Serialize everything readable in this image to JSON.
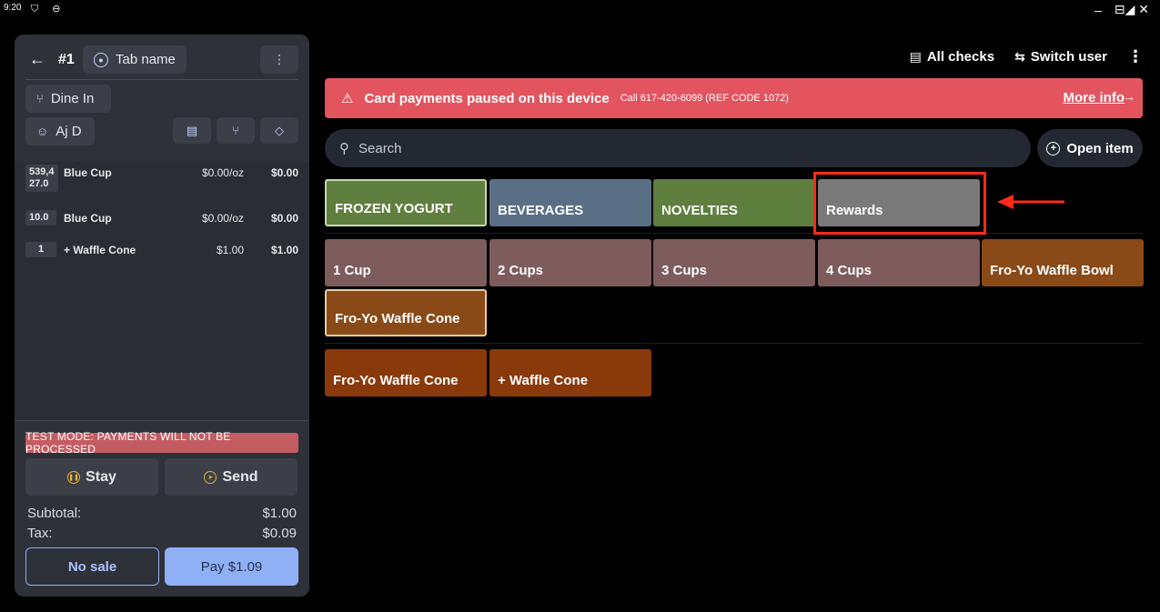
{
  "status_bar": {
    "time": "9:20",
    "left_icons": "⛉ ⊖",
    "minimize": "–",
    "right_icons": "⊟◢ ✕"
  },
  "check": {
    "back_arrow": "←",
    "number": "#1",
    "tab_name": "Tab name",
    "kebab": "⋮",
    "dine_in": "Dine In",
    "server": "Aj D"
  },
  "order_items": [
    {
      "qty": "539,4\n27.0",
      "name": "Blue Cup",
      "unit": "$0.00/oz",
      "total": "$0.00"
    },
    {
      "qty": "10.0",
      "name": "Blue Cup",
      "unit": "$0.00/oz",
      "total": "$0.00"
    },
    {
      "qty": "1",
      "name": "+ Waffle Cone",
      "unit": "$1.00",
      "total": "$1.00"
    }
  ],
  "footer": {
    "test_mode": "TEST MODE:  PAYMENTS WILL NOT BE PROCESSED",
    "stay": "Stay",
    "send": "Send",
    "subtotal_label": "Subtotal:",
    "subtotal_value": "$1.00",
    "tax_label": "Tax:",
    "tax_value": "$0.09",
    "no_sale": "No sale",
    "pay": "Pay $1.09"
  },
  "top_actions": {
    "all_checks": "All checks",
    "switch_user": "Switch user",
    "kebab": "⋮"
  },
  "banner": {
    "message": "Card payments paused on this device",
    "phone": "Call 617-420-6099 (REF CODE 1072)",
    "more_info": "More info",
    "arrow": "→",
    "color": "#e3545f"
  },
  "search": {
    "placeholder": "Search",
    "open_item": "Open item"
  },
  "categories": [
    {
      "label": "FROZEN YOGURT",
      "color": "#5f7f3f"
    },
    {
      "label": "BEVERAGES",
      "color": "#5a6f85"
    },
    {
      "label": "NOVELTIES",
      "color": "#5f7f3f"
    },
    {
      "label": "Rewards",
      "color": "#7a7a7a"
    }
  ],
  "items_row1": [
    {
      "label": "1 Cup",
      "color": "#7e5c5c"
    },
    {
      "label": "2 Cups",
      "color": "#7e5c5c"
    },
    {
      "label": "3 Cups",
      "color": "#7e5c5c"
    },
    {
      "label": "4 Cups",
      "color": "#7e5c5c"
    },
    {
      "label": "Fro-Yo Waffle Bowl",
      "color": "#8a4a17"
    }
  ],
  "items_row2": [
    {
      "label": "Fro-Yo Waffle Cone",
      "color": "#8a4a17"
    }
  ],
  "items_row3": [
    {
      "label": "Fro-Yo Waffle Cone",
      "color": "#8a3a0a"
    },
    {
      "label": "+ Waffle Cone",
      "color": "#8a3a0a"
    }
  ]
}
